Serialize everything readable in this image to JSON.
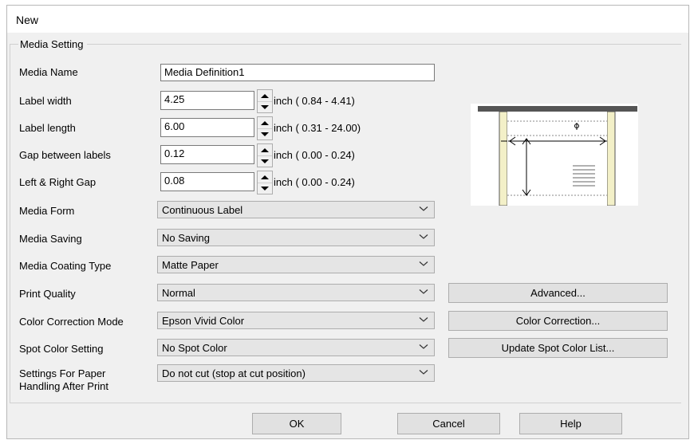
{
  "dialog": {
    "title": "New"
  },
  "media_setting": {
    "legend": "Media Setting",
    "media_name": {
      "label": "Media Name",
      "value": "Media Definition1"
    },
    "label_width": {
      "label": "Label width",
      "value": "4.25",
      "range": "inch ( 0.84 -  4.41)"
    },
    "label_length": {
      "label": "Label length",
      "value": "6.00",
      "range": "inch ( 0.31 - 24.00)"
    },
    "gap_between_labels": {
      "label": "Gap between labels",
      "value": "0.12",
      "range": "inch ( 0.00 -  0.24)"
    },
    "left_right_gap": {
      "label": "Left & Right Gap",
      "value": "0.08",
      "range": "inch ( 0.00 -  0.24)"
    },
    "media_form": {
      "label": "Media Form",
      "value": "Continuous Label"
    },
    "media_saving": {
      "label": "Media Saving",
      "value": "No Saving"
    },
    "media_coating_type": {
      "label": "Media Coating Type",
      "value": "Matte Paper"
    },
    "print_quality": {
      "label": "Print Quality",
      "value": "Normal"
    },
    "color_correction_mode": {
      "label": "Color Correction Mode",
      "value": "Epson Vivid Color"
    },
    "spot_color_setting": {
      "label": "Spot Color Setting",
      "value": "No Spot Color"
    },
    "paper_handling": {
      "label_line1": "Settings For Paper",
      "label_line2": "Handling After Print",
      "value": "Do not cut (stop at cut position)"
    }
  },
  "side_buttons": {
    "advanced": "Advanced...",
    "color_correction": "Color Correction...",
    "update_spot_color_list": "Update Spot Color List..."
  },
  "footer": {
    "ok": "OK",
    "cancel": "Cancel",
    "help": "Help"
  },
  "icons": {
    "spinner_up": "triangle-up-icon",
    "spinner_down": "triangle-down-icon",
    "combo_arrow": "chevron-down-icon"
  }
}
